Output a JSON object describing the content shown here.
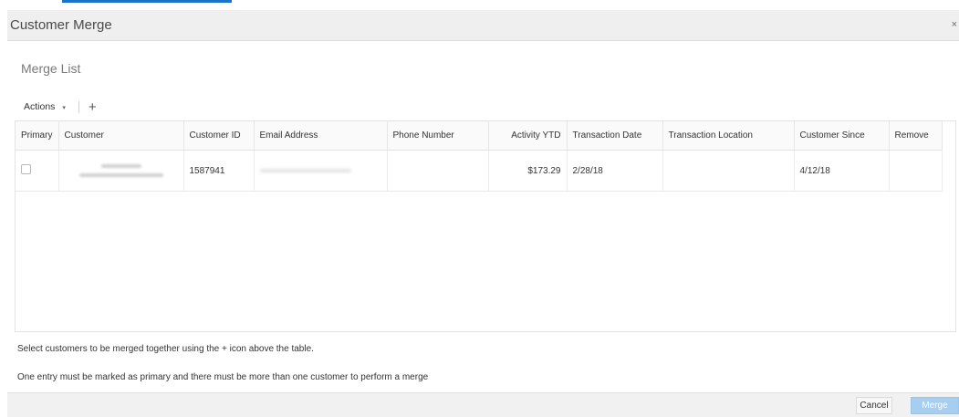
{
  "dialog": {
    "title": "Customer Merge",
    "close_icon": "×"
  },
  "section": {
    "title": "Merge List"
  },
  "toolbar": {
    "actions_label": "Actions",
    "actions_caret": "▾",
    "add_icon": "+"
  },
  "table": {
    "columns": [
      "Primary",
      "Customer",
      "Customer ID",
      "Email Address",
      "Phone Number",
      "Activity YTD",
      "Transaction Date",
      "Transaction Location",
      "Customer Since",
      "Remove"
    ],
    "rows": [
      {
        "customer_id": "1587941",
        "email": "",
        "phone": "",
        "activity_ytd": "$173.29",
        "transaction_date": "2/28/18",
        "transaction_location": "",
        "customer_since": "4/12/18",
        "remove": ""
      }
    ]
  },
  "hints": {
    "line1": "Select customers to be merged together using the + icon above the table.",
    "line2": "One entry must be marked as primary and there must be more than one customer to perform a merge"
  },
  "footer": {
    "cancel_label": "Cancel",
    "merge_label": "Merge"
  },
  "colors": {
    "accent": "#1a73c8",
    "merge_button_disabled": "#a7cdf0"
  }
}
